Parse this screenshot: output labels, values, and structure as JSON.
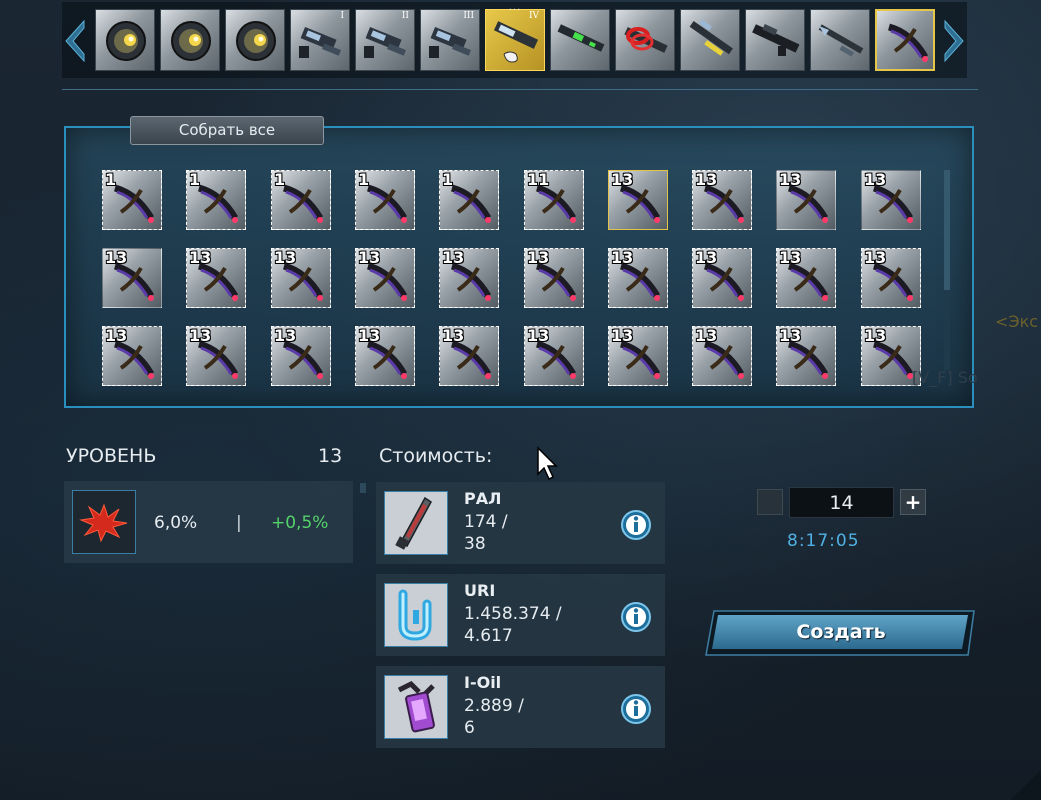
{
  "weapon_strip": {
    "slots": [
      {
        "icon": "sphere-turret-icon",
        "roman": "",
        "state": "normal"
      },
      {
        "icon": "sphere-turret-icon",
        "roman": "",
        "state": "normal"
      },
      {
        "icon": "sphere-turret-icon",
        "roman": "",
        "state": "normal"
      },
      {
        "icon": "blaster-icon",
        "roman": "I",
        "state": "normal"
      },
      {
        "icon": "blaster-icon",
        "roman": "II",
        "state": "normal"
      },
      {
        "icon": "blaster-icon",
        "roman": "III",
        "state": "normal"
      },
      {
        "icon": "cannon-icon",
        "roman": "IV",
        "state": "gold"
      },
      {
        "icon": "green-laser-icon",
        "roman": "",
        "state": "normal"
      },
      {
        "icon": "red-ring-gun-icon",
        "roman": "",
        "state": "normal"
      },
      {
        "icon": "yellow-rifle-icon",
        "roman": "",
        "state": "normal"
      },
      {
        "icon": "dark-rifle-icon",
        "roman": "",
        "state": "normal"
      },
      {
        "icon": "spear-gun-icon",
        "roman": "",
        "state": "normal"
      },
      {
        "icon": "purple-blade-icon",
        "roman": "",
        "state": "framed"
      }
    ],
    "more_indicator": "..."
  },
  "inventory": {
    "collect_all_label": "Собрать все",
    "rows": [
      [
        "1",
        "1",
        "1",
        "1",
        "1",
        "11",
        "13",
        "13",
        "13",
        "13"
      ],
      [
        "13",
        "13",
        "13",
        "13",
        "13",
        "13",
        "13",
        "13",
        "13",
        "13"
      ],
      [
        "13",
        "13",
        "13",
        "13",
        "13",
        "13",
        "13",
        "13",
        "13",
        "13"
      ]
    ],
    "selected_cell": 6
  },
  "level": {
    "label": "УРОВЕНЬ",
    "value": "13",
    "bonus_base": "6,0%",
    "separator": "|",
    "bonus_plus": "+0,5%"
  },
  "cost": {
    "label": "Стоимость:",
    "resources": [
      {
        "name": "РАЛ",
        "have": "174 /",
        "need": "38",
        "icon": "blade-shard-icon"
      },
      {
        "name": "URI",
        "have": "1.458.374 /",
        "need": "4.617",
        "icon": "uri-pipe-icon"
      },
      {
        "name": "I-Oil",
        "have": "2.889 /",
        "need": "6",
        "icon": "oil-canister-icon"
      }
    ]
  },
  "craft": {
    "quantity": "14",
    "plus_label": "+",
    "timer": "8:17:05",
    "create_label": "Создать"
  },
  "background": {
    "chat_fragment_1": "<Экс",
    "chat_fragment_2": "[V_F] So"
  }
}
